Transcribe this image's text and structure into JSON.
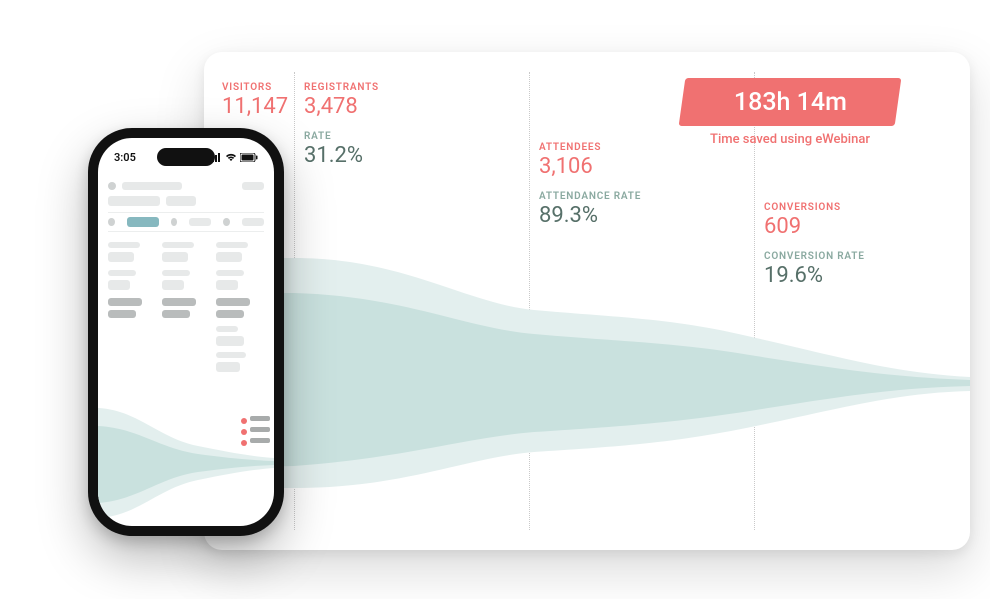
{
  "dashboard": {
    "stats": {
      "visitors": {
        "label": "VISITORS",
        "value": "11,147"
      },
      "registrants": {
        "label": "REGISTRANTS",
        "value": "3,478",
        "rate_label": "RATE",
        "rate_value": "31.2%"
      },
      "attendees": {
        "label": "ATTENDEES",
        "value": "3,106",
        "rate_label": "ATTENDANCE RATE",
        "rate_value": "89.3%"
      },
      "conversions": {
        "label": "CONVERSIONS",
        "value": "609",
        "rate_label": "CONVERSION RATE",
        "rate_value": "19.6%"
      }
    },
    "time_saved": {
      "value": "183h 14m",
      "caption": "Time saved using eWebinar"
    }
  },
  "phone": {
    "time": "3:05"
  },
  "colors": {
    "accent_red": "#f07171",
    "teal_light": "#d0e6e4",
    "teal_lighter": "#e3efee",
    "text_muted": "#577069"
  },
  "chart_data": {
    "type": "area",
    "description": "Conversion funnel – band width proportional to count at each stage",
    "stages": [
      {
        "name": "Visitors",
        "value": 11147
      },
      {
        "name": "Registrants",
        "value": 3478,
        "rate": 0.312
      },
      {
        "name": "Attendees",
        "value": 3106,
        "rate": 0.893
      },
      {
        "name": "Conversions",
        "value": 609,
        "rate": 0.196
      }
    ]
  }
}
